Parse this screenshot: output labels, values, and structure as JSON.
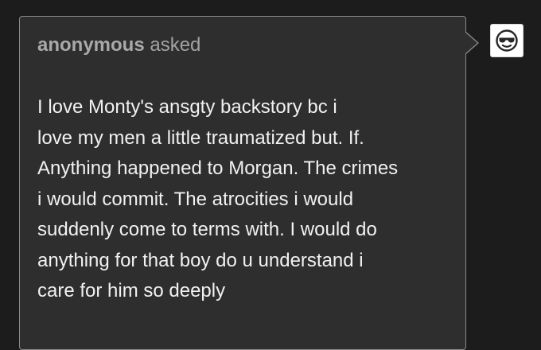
{
  "ask": {
    "asker_name": "anonymous",
    "asked_label": "asked",
    "body_lines": [
      "I love Monty's ansgty backstory bc i",
      "love my men a little traumatized but. If.",
      "Anything happened to Morgan. The crimes",
      "i would commit. The atrocities i would",
      "suddenly come to terms with. I would do",
      "anything for that boy do u understand i",
      "care for him so deeply"
    ]
  },
  "avatar": {
    "icon": "anonymous-sunglasses-avatar-icon"
  },
  "colors": {
    "page_background": "#1c1c1c",
    "card_background": "#2e2e2e",
    "card_border": "#8a8a8a",
    "header_text": "#a2a2a2",
    "body_text": "#f1f1f1"
  }
}
